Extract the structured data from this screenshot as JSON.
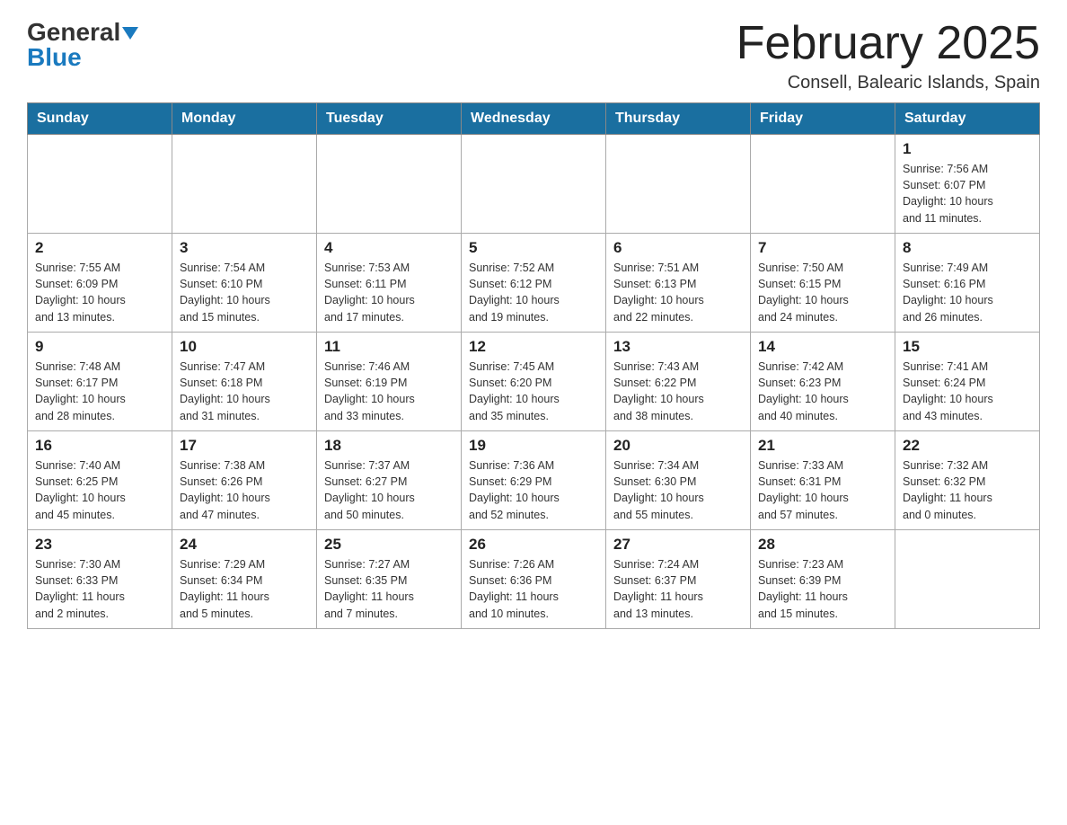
{
  "header": {
    "logo_general": "General",
    "logo_blue": "Blue",
    "month_title": "February 2025",
    "location": "Consell, Balearic Islands, Spain"
  },
  "days_of_week": [
    "Sunday",
    "Monday",
    "Tuesday",
    "Wednesday",
    "Thursday",
    "Friday",
    "Saturday"
  ],
  "weeks": [
    {
      "cells": [
        {
          "day": "",
          "info": ""
        },
        {
          "day": "",
          "info": ""
        },
        {
          "day": "",
          "info": ""
        },
        {
          "day": "",
          "info": ""
        },
        {
          "day": "",
          "info": ""
        },
        {
          "day": "",
          "info": ""
        },
        {
          "day": "1",
          "info": "Sunrise: 7:56 AM\nSunset: 6:07 PM\nDaylight: 10 hours\nand 11 minutes."
        }
      ]
    },
    {
      "cells": [
        {
          "day": "2",
          "info": "Sunrise: 7:55 AM\nSunset: 6:09 PM\nDaylight: 10 hours\nand 13 minutes."
        },
        {
          "day": "3",
          "info": "Sunrise: 7:54 AM\nSunset: 6:10 PM\nDaylight: 10 hours\nand 15 minutes."
        },
        {
          "day": "4",
          "info": "Sunrise: 7:53 AM\nSunset: 6:11 PM\nDaylight: 10 hours\nand 17 minutes."
        },
        {
          "day": "5",
          "info": "Sunrise: 7:52 AM\nSunset: 6:12 PM\nDaylight: 10 hours\nand 19 minutes."
        },
        {
          "day": "6",
          "info": "Sunrise: 7:51 AM\nSunset: 6:13 PM\nDaylight: 10 hours\nand 22 minutes."
        },
        {
          "day": "7",
          "info": "Sunrise: 7:50 AM\nSunset: 6:15 PM\nDaylight: 10 hours\nand 24 minutes."
        },
        {
          "day": "8",
          "info": "Sunrise: 7:49 AM\nSunset: 6:16 PM\nDaylight: 10 hours\nand 26 minutes."
        }
      ]
    },
    {
      "cells": [
        {
          "day": "9",
          "info": "Sunrise: 7:48 AM\nSunset: 6:17 PM\nDaylight: 10 hours\nand 28 minutes."
        },
        {
          "day": "10",
          "info": "Sunrise: 7:47 AM\nSunset: 6:18 PM\nDaylight: 10 hours\nand 31 minutes."
        },
        {
          "day": "11",
          "info": "Sunrise: 7:46 AM\nSunset: 6:19 PM\nDaylight: 10 hours\nand 33 minutes."
        },
        {
          "day": "12",
          "info": "Sunrise: 7:45 AM\nSunset: 6:20 PM\nDaylight: 10 hours\nand 35 minutes."
        },
        {
          "day": "13",
          "info": "Sunrise: 7:43 AM\nSunset: 6:22 PM\nDaylight: 10 hours\nand 38 minutes."
        },
        {
          "day": "14",
          "info": "Sunrise: 7:42 AM\nSunset: 6:23 PM\nDaylight: 10 hours\nand 40 minutes."
        },
        {
          "day": "15",
          "info": "Sunrise: 7:41 AM\nSunset: 6:24 PM\nDaylight: 10 hours\nand 43 minutes."
        }
      ]
    },
    {
      "cells": [
        {
          "day": "16",
          "info": "Sunrise: 7:40 AM\nSunset: 6:25 PM\nDaylight: 10 hours\nand 45 minutes."
        },
        {
          "day": "17",
          "info": "Sunrise: 7:38 AM\nSunset: 6:26 PM\nDaylight: 10 hours\nand 47 minutes."
        },
        {
          "day": "18",
          "info": "Sunrise: 7:37 AM\nSunset: 6:27 PM\nDaylight: 10 hours\nand 50 minutes."
        },
        {
          "day": "19",
          "info": "Sunrise: 7:36 AM\nSunset: 6:29 PM\nDaylight: 10 hours\nand 52 minutes."
        },
        {
          "day": "20",
          "info": "Sunrise: 7:34 AM\nSunset: 6:30 PM\nDaylight: 10 hours\nand 55 minutes."
        },
        {
          "day": "21",
          "info": "Sunrise: 7:33 AM\nSunset: 6:31 PM\nDaylight: 10 hours\nand 57 minutes."
        },
        {
          "day": "22",
          "info": "Sunrise: 7:32 AM\nSunset: 6:32 PM\nDaylight: 11 hours\nand 0 minutes."
        }
      ]
    },
    {
      "cells": [
        {
          "day": "23",
          "info": "Sunrise: 7:30 AM\nSunset: 6:33 PM\nDaylight: 11 hours\nand 2 minutes."
        },
        {
          "day": "24",
          "info": "Sunrise: 7:29 AM\nSunset: 6:34 PM\nDaylight: 11 hours\nand 5 minutes."
        },
        {
          "day": "25",
          "info": "Sunrise: 7:27 AM\nSunset: 6:35 PM\nDaylight: 11 hours\nand 7 minutes."
        },
        {
          "day": "26",
          "info": "Sunrise: 7:26 AM\nSunset: 6:36 PM\nDaylight: 11 hours\nand 10 minutes."
        },
        {
          "day": "27",
          "info": "Sunrise: 7:24 AM\nSunset: 6:37 PM\nDaylight: 11 hours\nand 13 minutes."
        },
        {
          "day": "28",
          "info": "Sunrise: 7:23 AM\nSunset: 6:39 PM\nDaylight: 11 hours\nand 15 minutes."
        },
        {
          "day": "",
          "info": ""
        }
      ]
    }
  ]
}
